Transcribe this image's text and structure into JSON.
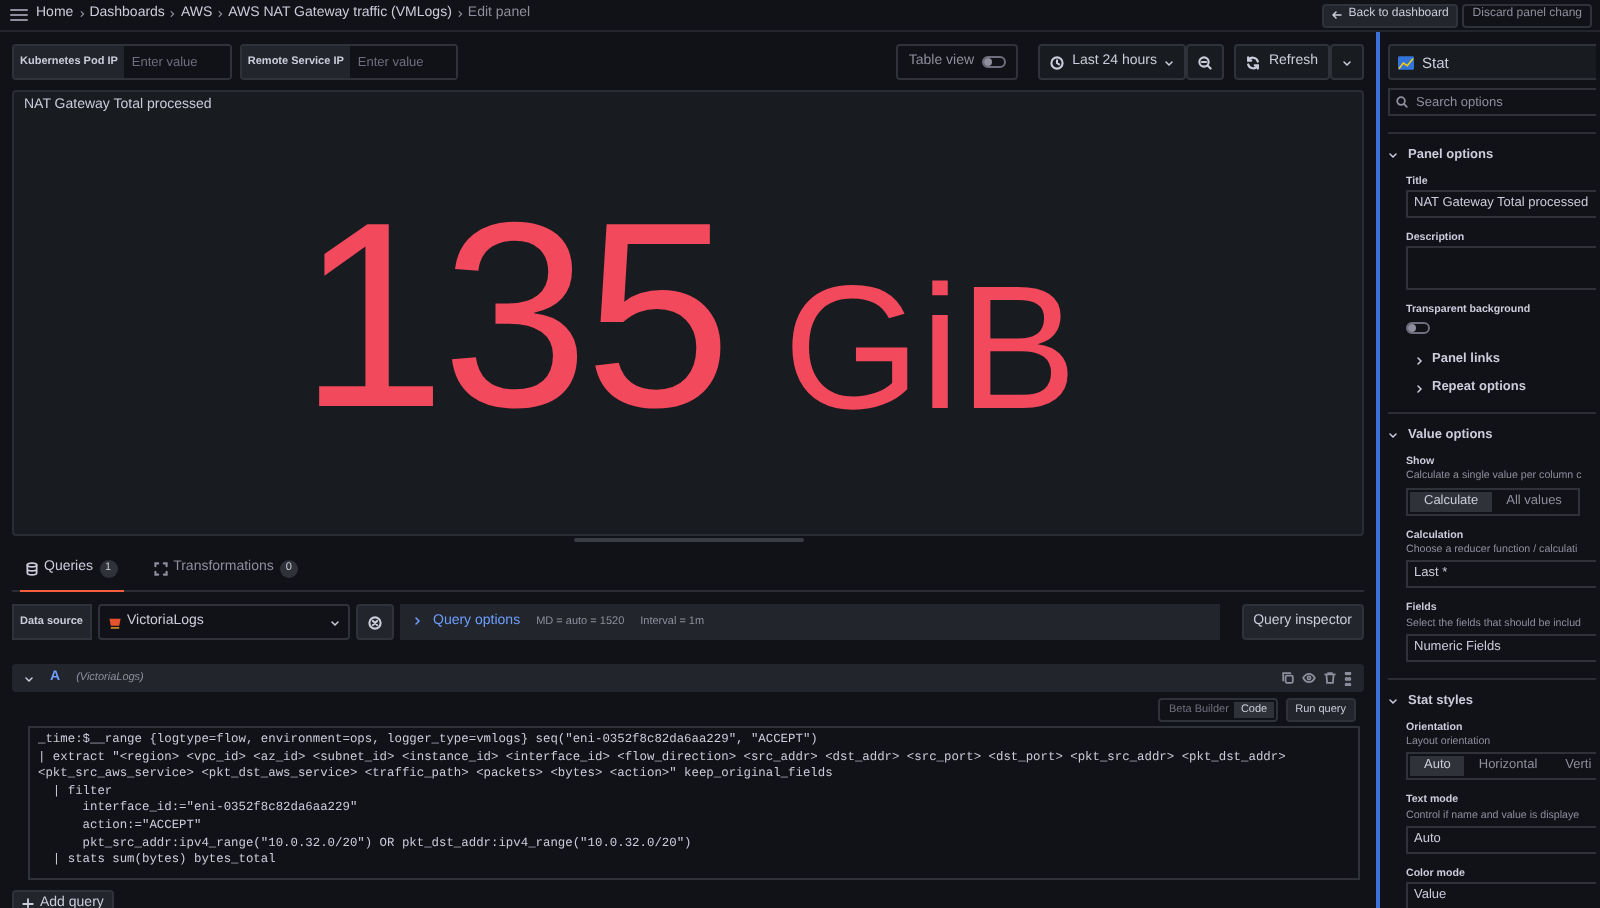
{
  "breadcrumbs": [
    {
      "label": "Home",
      "current": false
    },
    {
      "label": "Dashboards",
      "current": false
    },
    {
      "label": "AWS",
      "current": false
    },
    {
      "label": "AWS NAT Gateway traffic (VMLogs)",
      "current": false
    },
    {
      "label": "Edit panel",
      "current": true
    }
  ],
  "header_actions": [
    {
      "label": "Back to dashboard",
      "kind": "back"
    },
    {
      "label": "Discard panel chang",
      "kind": "plain"
    }
  ],
  "variables": [
    {
      "label": "Kubernetes Pod IP",
      "placeholder": "Enter value"
    },
    {
      "label": "Remote Service IP",
      "placeholder": "Enter value"
    }
  ],
  "toolbar": {
    "table_view": {
      "label": "Table view",
      "on": false
    },
    "time_range": "Last 24 hours",
    "refresh": "Refresh"
  },
  "panel": {
    "title": "NAT Gateway Total processed",
    "value": "135",
    "unit": "GiB",
    "color": "#f2495c"
  },
  "query_tabs": [
    {
      "label": "Queries",
      "count": "1",
      "selected": true
    },
    {
      "label": "Transformations",
      "count": "0",
      "selected": false
    }
  ],
  "data_source": {
    "label": "Data source",
    "value": "VictoriaLogs"
  },
  "query_options": {
    "label": "Query options",
    "max_data_points": "MD = auto = 1520",
    "interval": "Interval = 1m"
  },
  "query_inspector": "Query inspector",
  "query": {
    "ref": "A",
    "datasource": "(VictoriaLogs)",
    "modes": [
      {
        "label": "Beta Builder",
        "selected": false
      },
      {
        "label": "Code",
        "selected": true
      }
    ],
    "run": "Run query",
    "code": [
      "_time:$__range {logtype=flow, environment=ops, logger_type=vmlogs} seq(\"eni-0352f8c82da6aa229\", \"ACCEPT\")",
      "| extract \"<region> <vpc_id> <az_id> <subnet_id> <instance_id> <interface_id> <flow_direction> <src_addr> <dst_addr> <src_port> <dst_port> <pkt_src_addr> <pkt_dst_addr>",
      "<pkt_src_aws_service> <pkt_dst_aws_service> <traffic_path> <packets> <bytes> <action>\" keep_original_fields",
      "  | filter",
      "      interface_id:=\"eni-0352f8c82da6aa229\"",
      "      action:=\"ACCEPT\"",
      "      pkt_src_addr:ipv4_range(\"10.0.32.0/20\") OR pkt_dst_addr:ipv4_range(\"10.0.32.0/20\")",
      "  | stats sum(bytes) bytes_total"
    ]
  },
  "add_query": "Add query",
  "sidebar": {
    "visualization": "Stat",
    "search_placeholder": "Search options",
    "sections": [
      {
        "label": "Panel options",
        "expanded": true,
        "items": [
          {
            "kind": "text",
            "label": "Title",
            "value": "NAT Gateway Total processed"
          },
          {
            "kind": "textarea",
            "label": "Description"
          },
          {
            "kind": "switch",
            "label": "Transparent background",
            "on": false
          },
          {
            "kind": "collapsible",
            "label": "Panel links",
            "expanded": false
          },
          {
            "kind": "collapsible",
            "label": "Repeat options",
            "expanded": false
          }
        ]
      },
      {
        "label": "Value options",
        "expanded": true,
        "items": [
          {
            "kind": "radio",
            "label": "Show",
            "hint": "Calculate a single value per column c",
            "options": [
              {
                "label": "Calculate",
                "selected": true
              },
              {
                "label": "All values",
                "selected": false
              }
            ]
          },
          {
            "kind": "select",
            "label": "Calculation",
            "hint": "Choose a reducer function / calculati",
            "value": "Last *"
          },
          {
            "kind": "select",
            "label": "Fields",
            "hint": "Select the fields that should be includ",
            "value": "Numeric Fields"
          }
        ]
      },
      {
        "label": "Stat styles",
        "expanded": true,
        "items": [
          {
            "kind": "radio",
            "label": "Orientation",
            "hint": "Layout orientation",
            "options": [
              {
                "label": "Auto",
                "selected": true
              },
              {
                "label": "Horizontal",
                "selected": false
              },
              {
                "label": "Verti",
                "selected": false
              }
            ]
          },
          {
            "kind": "select",
            "label": "Text mode",
            "hint": "Control if name and value is displaye",
            "value": "Auto"
          },
          {
            "kind": "select",
            "label": "Color mode",
            "value": "Value"
          }
        ]
      }
    ]
  }
}
